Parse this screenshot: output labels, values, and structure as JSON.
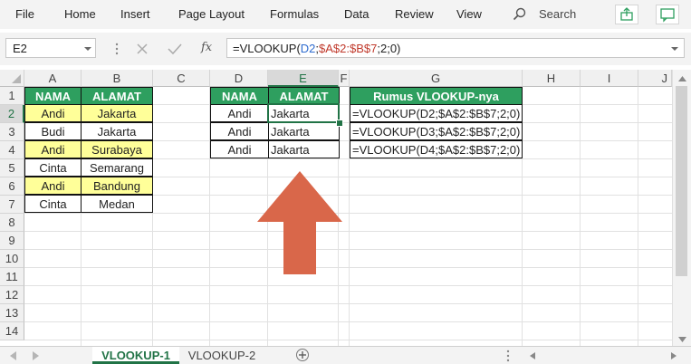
{
  "menu": {
    "items": [
      "File",
      "Home",
      "Insert",
      "Page Layout",
      "Formulas",
      "Data",
      "Review",
      "View"
    ],
    "search_label": "Search"
  },
  "formula_bar": {
    "name_box": "E2",
    "formula_prefix": "=VLOOKUP(",
    "formula_ref1": "D2",
    "formula_sep": ";",
    "formula_ref2": "$A$2:$B$7",
    "formula_suffix": ";2;0)",
    "ref1_color": "#2f6ccf",
    "ref2_color": "#c0392b"
  },
  "columns": [
    "A",
    "B",
    "C",
    "D",
    "E",
    "F",
    "G",
    "H",
    "I",
    "J"
  ],
  "rows": [
    "1",
    "2",
    "3",
    "4",
    "5",
    "6",
    "7",
    "8",
    "9",
    "10",
    "11",
    "12",
    "13",
    "14"
  ],
  "table1": {
    "headers": [
      "NAMA",
      "ALAMAT"
    ],
    "rows": [
      [
        "Andi",
        "Jakarta"
      ],
      [
        "Budi",
        "Jakarta"
      ],
      [
        "Andi",
        "Surabaya"
      ],
      [
        "Cinta",
        "Semarang"
      ],
      [
        "Andi",
        "Bandung"
      ],
      [
        "Cinta",
        "Medan"
      ]
    ],
    "highlight_color": "#ffff99"
  },
  "table2": {
    "headers": [
      "NAMA",
      "ALAMAT"
    ],
    "rows": [
      [
        "Andi",
        "Jakarta"
      ],
      [
        "Andi",
        "Jakarta"
      ],
      [
        "Andi",
        "Jakarta"
      ]
    ]
  },
  "table3": {
    "header": "Rumus VLOOKUP-nya",
    "rows": [
      "=VLOOKUP(D2;$A$2:$B$7;2;0)",
      "=VLOOKUP(D3;$A$2:$B$7;2;0)",
      "=VLOOKUP(D4;$A$2:$B$7;2;0)"
    ]
  },
  "colors": {
    "header_green": "#2e9f5f",
    "arrow": "#d9674a",
    "selection": "#217346"
  },
  "sheets": {
    "tabs": [
      "VLOOKUP-1",
      "VLOOKUP-2"
    ],
    "active": "VLOOKUP-1"
  }
}
